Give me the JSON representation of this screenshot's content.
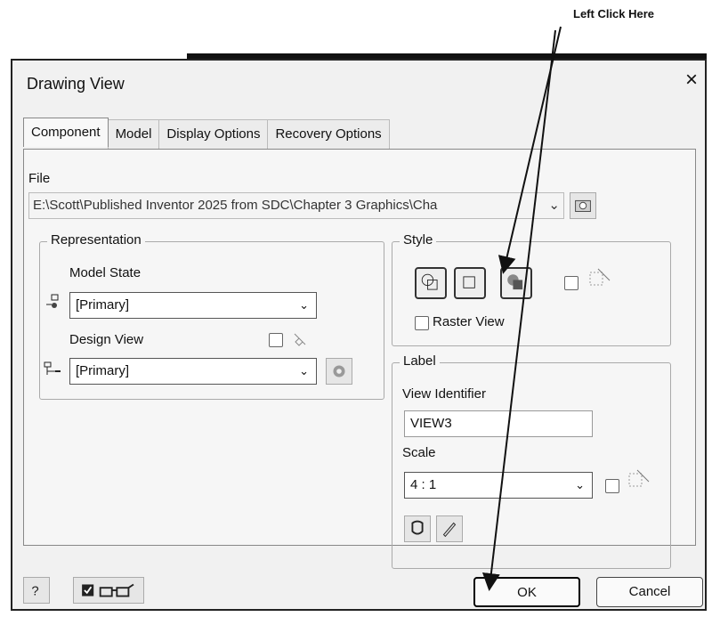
{
  "callout": {
    "text": "Left Click Here"
  },
  "dialog": {
    "title": "Drawing View",
    "close_glyph": "×",
    "tabs": [
      "Component",
      "Model",
      "Display Options",
      "Recovery Options"
    ],
    "file": {
      "label": "File",
      "path": "E:\\Scott\\Published Inventor 2025 from SDC\\Chapter 3 Graphics\\Cha",
      "browse_icon": "folder-browse-icon"
    },
    "representation": {
      "title": "Representation",
      "model_state_label": "Model State",
      "model_state_value": "[Primary]",
      "design_view_label": "Design View",
      "design_view_value": "[Primary]"
    },
    "style": {
      "title": "Style",
      "buttons": [
        "hidden-line-icon",
        "hidden-line-removed-icon",
        "shaded-icon"
      ],
      "raster_view_label": "Raster View"
    },
    "label": {
      "title": "Label",
      "view_identifier_label": "View Identifier",
      "view_identifier_value": "VIEW3",
      "scale_label": "Scale",
      "scale_value": "4 : 1"
    },
    "footer": {
      "ok": "OK",
      "cancel": "Cancel"
    }
  }
}
